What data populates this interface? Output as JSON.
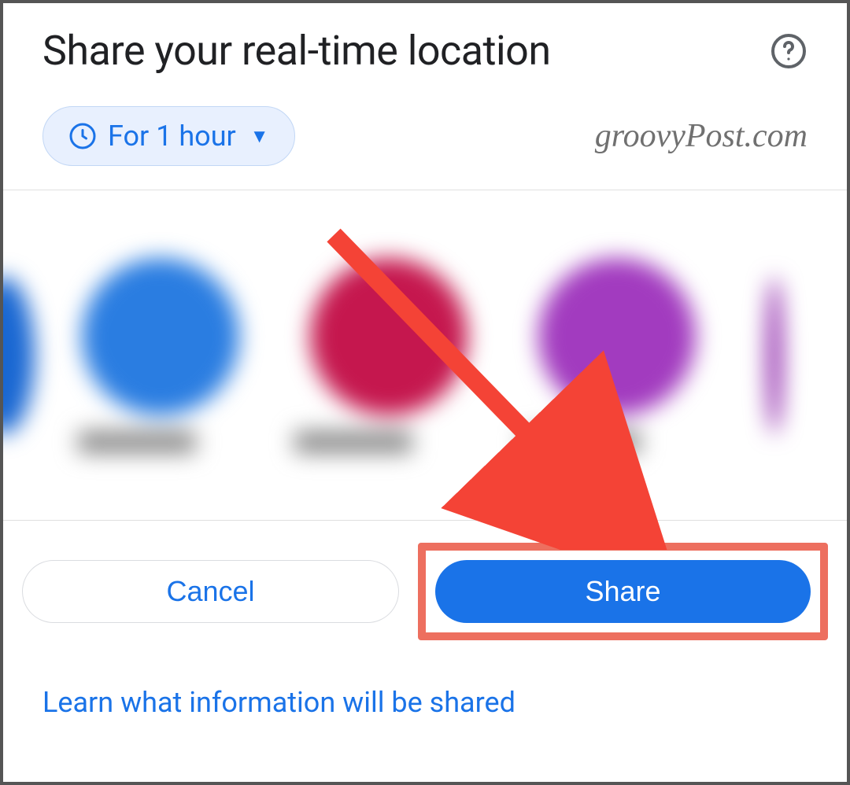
{
  "header": {
    "title": "Share your real-time location"
  },
  "chip": {
    "duration_label": "For 1 hour"
  },
  "watermark": "groovyPost.com",
  "buttons": {
    "cancel_label": "Cancel",
    "share_label": "Share"
  },
  "link": {
    "learn_label": "Learn what information will be shared"
  },
  "colors": {
    "primary": "#1a73e8",
    "chip_bg": "#e8f0fe",
    "highlight_border": "#ed6f5f",
    "arrow": "#f44336"
  }
}
